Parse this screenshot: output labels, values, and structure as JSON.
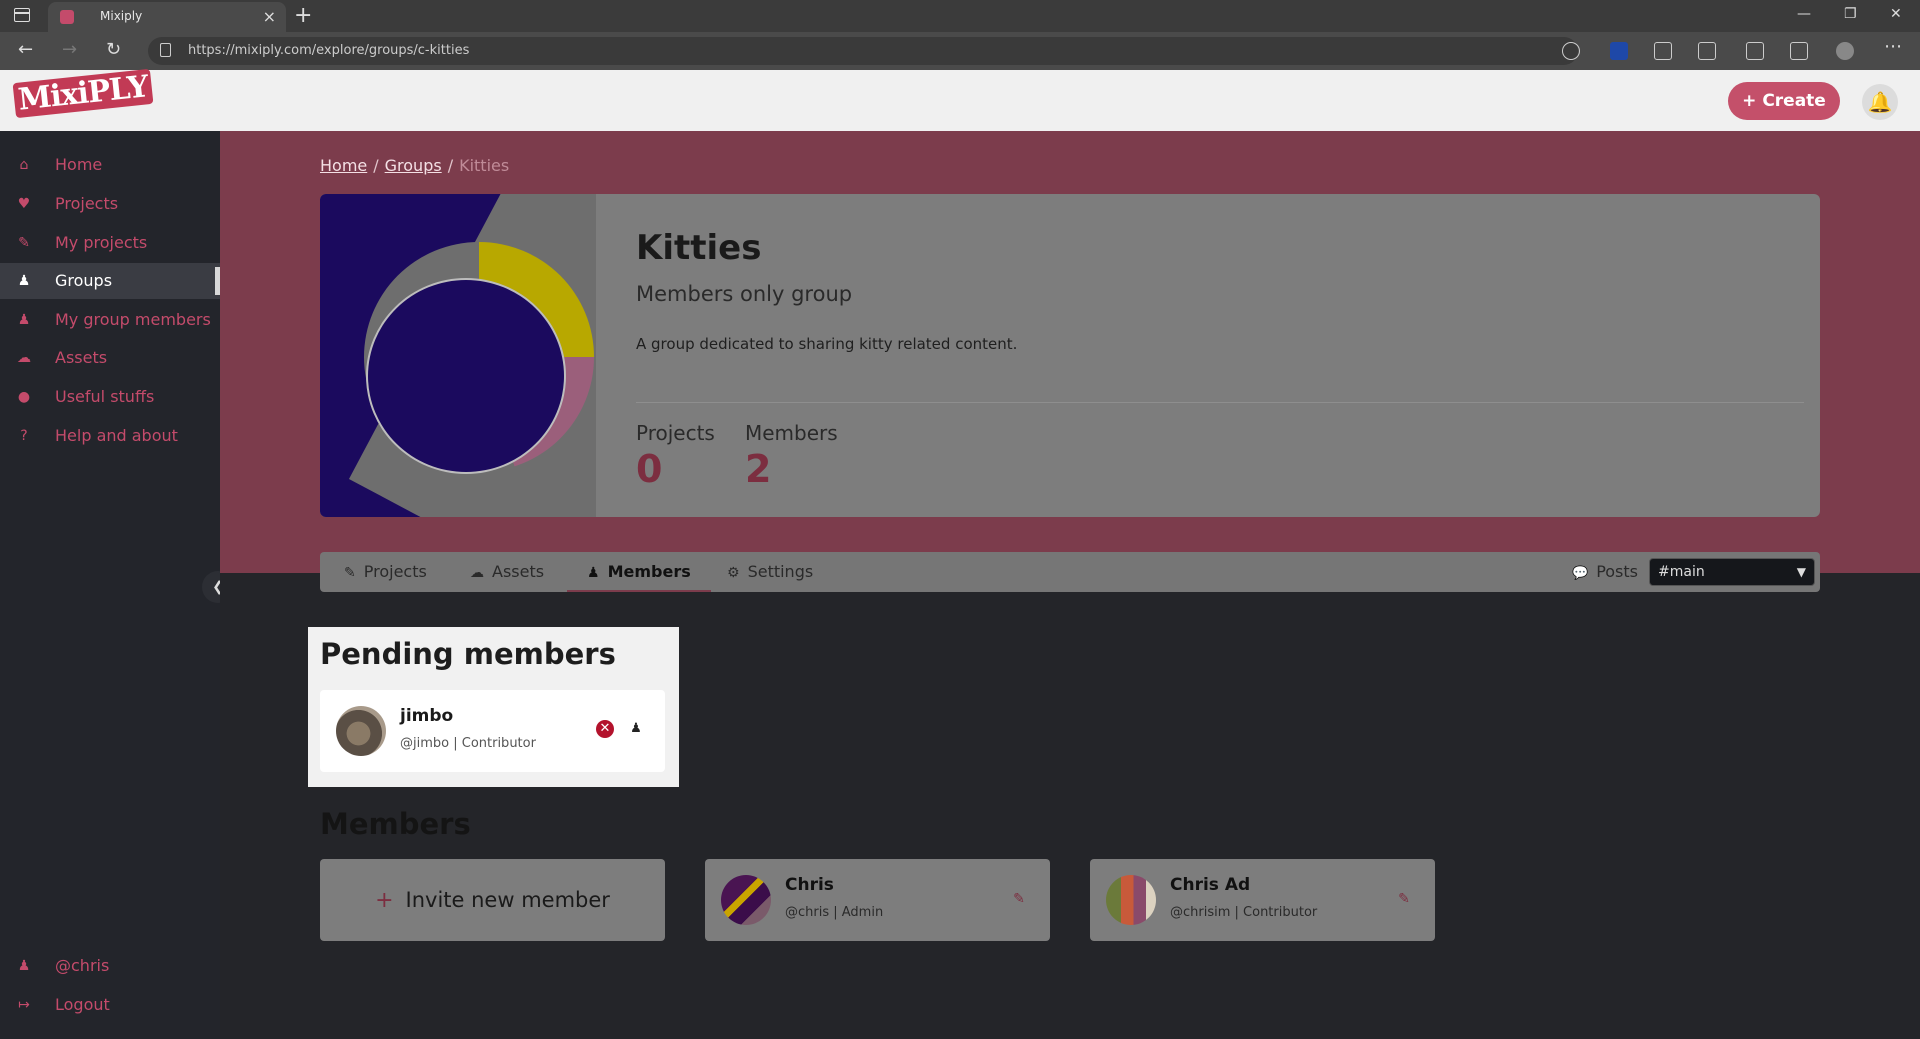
{
  "browser": {
    "tab_title": "Mixiply",
    "url": "https://mixiply.com/explore/groups/c-kitties",
    "tab_close": "×",
    "new_tab": "+"
  },
  "header": {
    "logo": "MixiPLY",
    "create_label": "Create"
  },
  "sidebar": {
    "items": [
      {
        "label": "Home",
        "icon": "home-icon"
      },
      {
        "label": "Projects",
        "icon": "heart-icon"
      },
      {
        "label": "My projects",
        "icon": "brush-icon"
      },
      {
        "label": "Groups",
        "icon": "users-icon"
      },
      {
        "label": "My group members",
        "icon": "users-group-icon"
      },
      {
        "label": "Assets",
        "icon": "cloud-icon"
      },
      {
        "label": "Useful stuffs",
        "icon": "lightbulb-icon"
      },
      {
        "label": "Help and about",
        "icon": "question-icon"
      }
    ],
    "user": "@chris",
    "logout": "Logout"
  },
  "breadcrumb": {
    "home": "Home",
    "sep": "/",
    "groups": "Groups",
    "current": "Kitties"
  },
  "group": {
    "title": "Kitties",
    "subtitle": "Members only group",
    "description": "A group dedicated to sharing kitty related content.",
    "stats": {
      "projects_label": "Projects",
      "projects_value": "0",
      "members_label": "Members",
      "members_value": "2"
    }
  },
  "group_tabs": {
    "projects": "Projects",
    "assets": "Assets",
    "members": "Members",
    "settings": "Settings",
    "posts": "Posts",
    "channel": "#main"
  },
  "pending": {
    "title": "Pending members",
    "members": [
      {
        "name": "jimbo",
        "meta": "@jimbo | Contributor"
      }
    ]
  },
  "members": {
    "title": "Members",
    "invite_label": "Invite new member",
    "list": [
      {
        "name": "Chris",
        "meta": "@chris | Admin"
      },
      {
        "name": "Chris Ad",
        "meta": "@chrisim | Contributor"
      }
    ]
  },
  "colors": {
    "accent": "#c4506a",
    "hero_band": "#7c3c4c",
    "sidebar_bg": "#23252b"
  }
}
